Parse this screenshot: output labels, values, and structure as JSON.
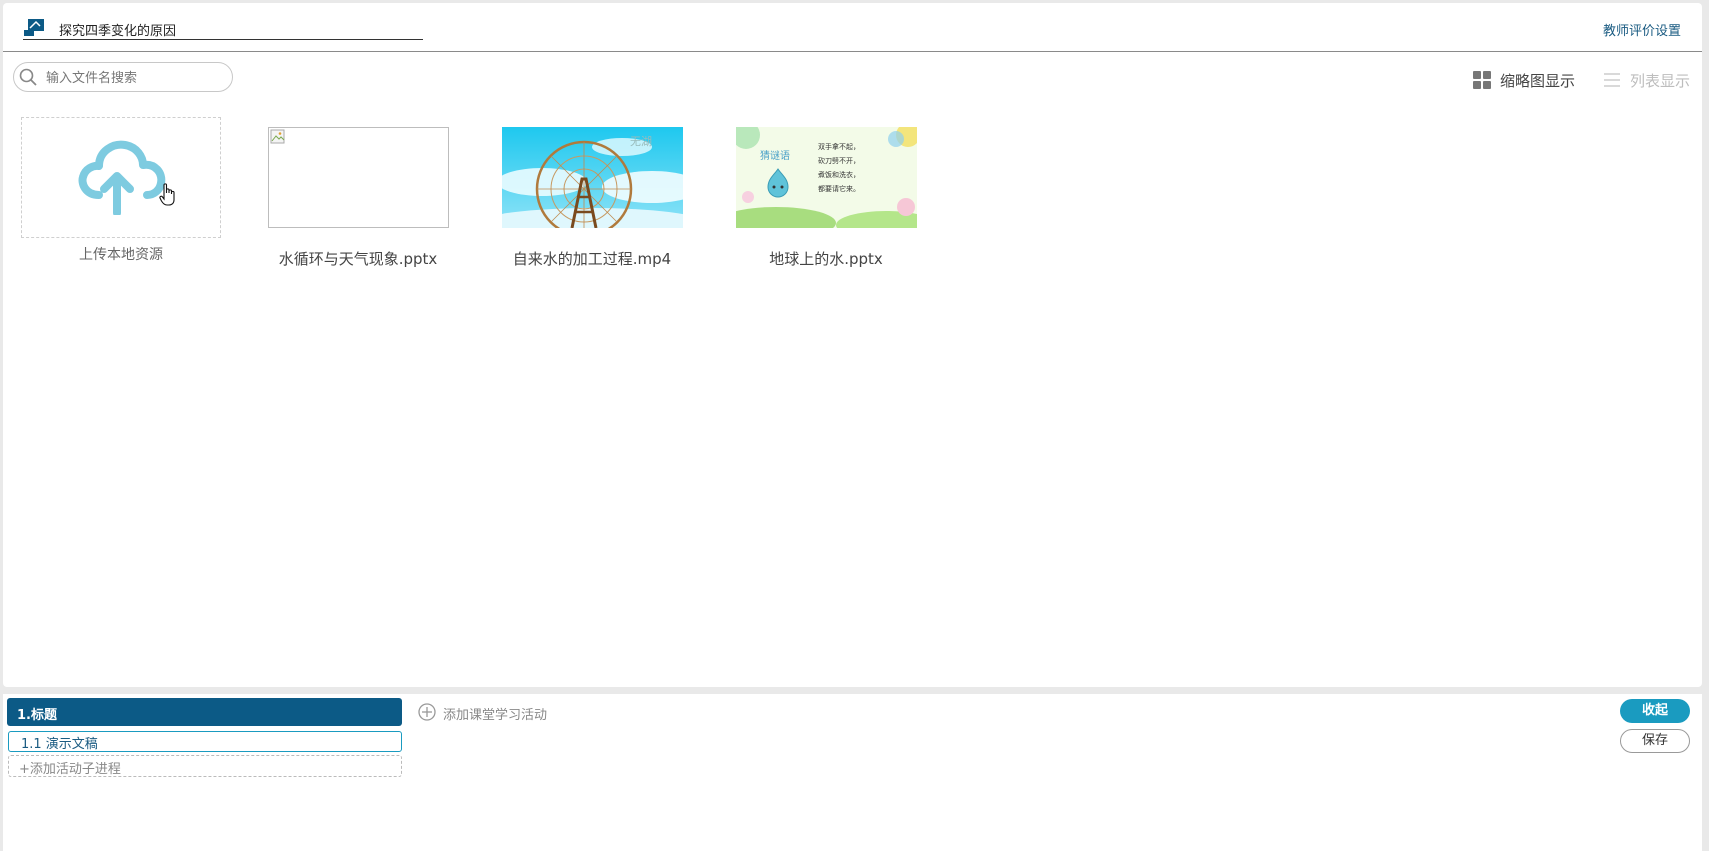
{
  "header": {
    "title": "探究四季变化的原因",
    "teacher_settings": "教师评价设置"
  },
  "search": {
    "placeholder": "输入文件名搜索",
    "value": ""
  },
  "view_toggle": {
    "thumbnail_label": "缩略图显示",
    "list_label": "列表显示",
    "active": "thumbnail"
  },
  "upload": {
    "label": "上传本地资源"
  },
  "files": [
    {
      "name": "水循环与天气现象.pptx",
      "thumbnail": "broken-image"
    },
    {
      "name": "自来水的加工过程.mp4",
      "thumbnail": "ferris-wheel-sky",
      "thumb_text": "无湖"
    },
    {
      "name": "地球上的水.pptx",
      "thumbnail": "riddle-slide",
      "thumb_text": "猜谜语",
      "thumb_lines": [
        "双手拿不起，",
        "砍刀劈不开，",
        "煮饭和洗衣，",
        "都要请它来。"
      ]
    }
  ],
  "activity": {
    "title": "1.标题",
    "add_activity": "添加课堂学习活动",
    "sub_items": [
      "1.1  演示文稿"
    ],
    "add_sub": "+添加活动子进程"
  },
  "buttons": {
    "collapse": "收起",
    "save": "保存"
  },
  "colors": {
    "primary": "#0c5a86",
    "accent": "#1a9bc0",
    "cloud": "#7ecbe0"
  }
}
